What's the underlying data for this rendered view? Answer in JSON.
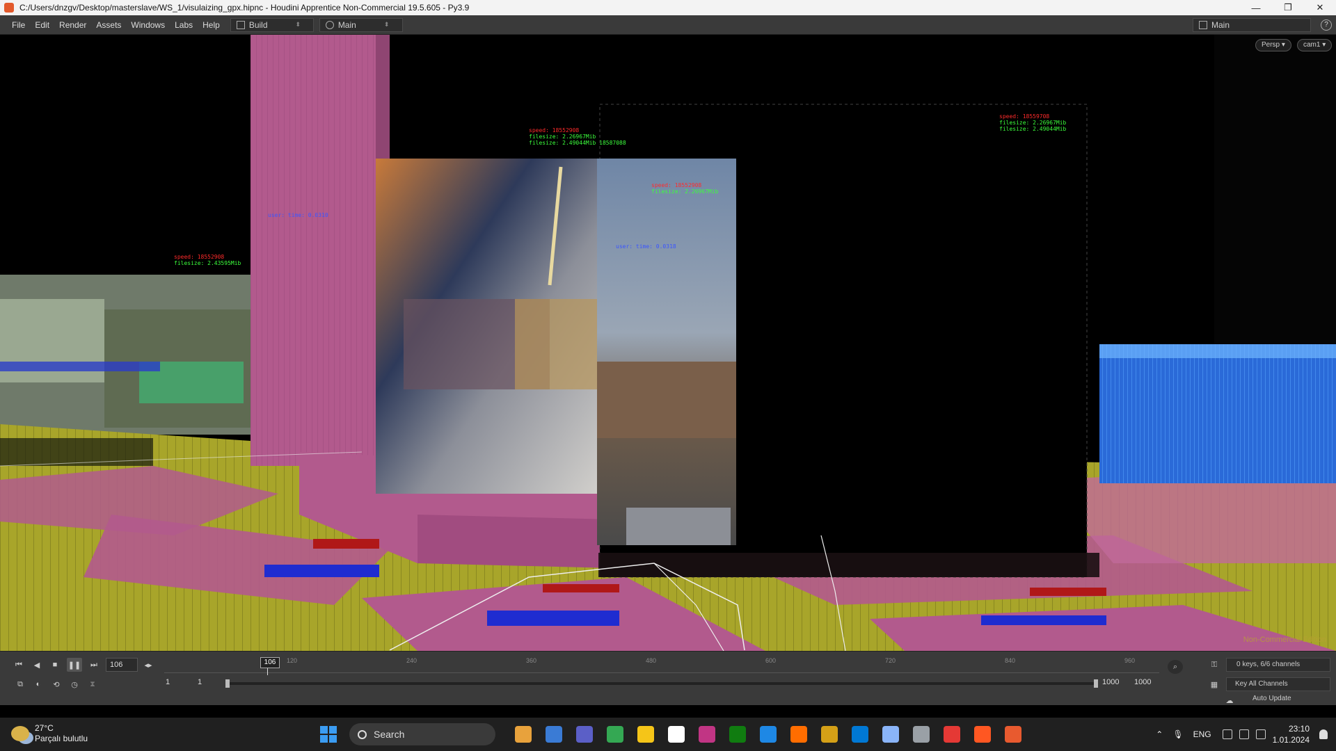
{
  "window": {
    "title": "C:/Users/dnzgv/Desktop/masterslave/WS_1/visulaizing_gpx.hipnc - Houdini Apprentice Non-Commercial 19.5.605 - Py3.9",
    "minimize": "—",
    "maximize": "❐",
    "close": "✕"
  },
  "menu": {
    "items": [
      "File",
      "Edit",
      "Render",
      "Assets",
      "Windows",
      "Labs",
      "Help"
    ],
    "desktop_build": "Build",
    "desktop_main": "Main",
    "desktop_right": "Main"
  },
  "viewport": {
    "camera_mode": "Persp ▾",
    "camera_name": "cam1 ▾",
    "watermark": "Non-Commercial Edition",
    "labels": [
      {
        "lines": [
          {
            "c": "r",
            "t": "speed: 18552908"
          },
          {
            "c": "g",
            "t": "filesize: 2.26967Mib"
          },
          {
            "c": "g",
            "t": "filesize: 2.49044Mib 18587088"
          }
        ]
      },
      {
        "lines": [
          {
            "c": "r",
            "t": "speed: 18559708"
          },
          {
            "c": "g",
            "t": "filesize: 2.26967Mib"
          },
          {
            "c": "g",
            "t": "filesize: 2.49044Mib"
          }
        ]
      },
      {
        "lines": [
          {
            "c": "r",
            "t": "speed: 18552908"
          },
          {
            "c": "g",
            "t": "filesize: 2.43595Mib"
          }
        ]
      },
      {
        "lines": [
          {
            "c": "r",
            "t": "speed: 18552908"
          },
          {
            "c": "g",
            "t": "filesize: 2.26967Mib"
          }
        ]
      },
      {
        "lines": [
          {
            "c": "b",
            "t": "user: time: 0.0310"
          }
        ]
      },
      {
        "lines": [
          {
            "c": "b",
            "t": "user: time: 0.0318"
          }
        ]
      }
    ]
  },
  "timeline": {
    "current_frame": "106",
    "frame_field": "106",
    "ruler_ticks": [
      "120",
      "240",
      "360",
      "480",
      "600",
      "720",
      "840",
      "960"
    ],
    "range_start": "1",
    "range_start2": "1",
    "range_end": "1000",
    "range_end2": "1000",
    "keys_info": "0 keys, 6/6 channels",
    "key_all": "Key All Channels",
    "auto_update": "Auto Update"
  },
  "taskbar": {
    "temperature": "27°C",
    "weather_desc": "Parçalı bulutlu",
    "search": "Search",
    "lang": "ENG",
    "time": "23:10",
    "date": "1.01.2024",
    "app_colors": [
      "#e8a23c",
      "#3a7bd5",
      "#5b5fc7",
      "#34a853",
      "#f5c518",
      "#ffffff",
      "#c13584",
      "#107c10",
      "#1e88e5",
      "#ff6d00",
      "#d4a017",
      "#0078d4",
      "#8ab4f8",
      "#9aa0a6",
      "#e53935",
      "#ff5722",
      "#e85a2f"
    ]
  },
  "colors": {
    "ground_yellow": "#a8a52a",
    "building_pink": "#b25a8d",
    "accent_houdini": "#e2592b"
  }
}
